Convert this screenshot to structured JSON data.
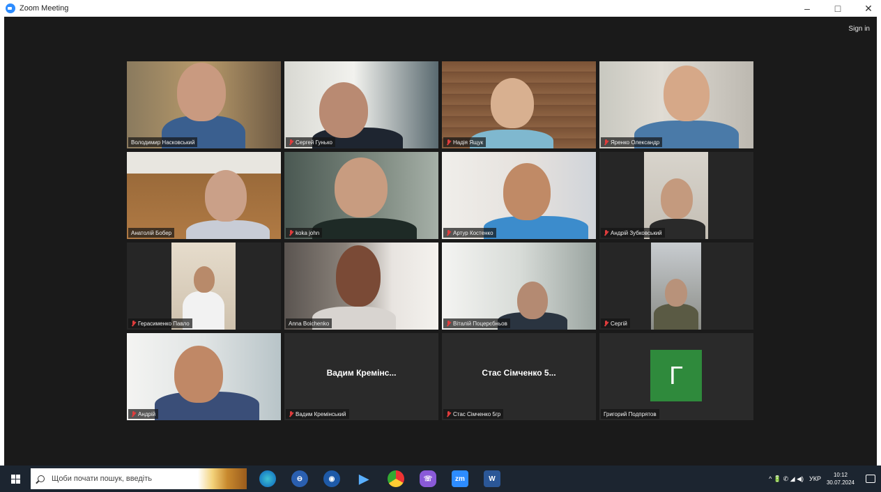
{
  "window": {
    "title": "Zoom Meeting",
    "controls": [
      "–",
      "□",
      "✕"
    ]
  },
  "meeting": {
    "sign_in": "Sign in",
    "participants": [
      {
        "name": "Володимир Насковський",
        "muted": false,
        "active": true
      },
      {
        "name": "Сергей Гунько",
        "muted": true
      },
      {
        "name": "Надія Ящук",
        "muted": true
      },
      {
        "name": "Яренко Олександр",
        "muted": true
      },
      {
        "name": "Анатолій Бобер",
        "muted": false
      },
      {
        "name": "koka john",
        "muted": true
      },
      {
        "name": "Артур Костенко",
        "muted": true
      },
      {
        "name": "Андрій Зубковський",
        "muted": true
      },
      {
        "name": "Герасименко Павло",
        "muted": true
      },
      {
        "name": "Anna Boichenko",
        "muted": false
      },
      {
        "name": "Віталій Поцерєбньов",
        "muted": true
      },
      {
        "name": "Сергій",
        "muted": true
      },
      {
        "name": "Андрій",
        "muted": true
      },
      {
        "name": "Вадим Кремінський",
        "muted": true,
        "video_off_label": "Вадим Кремінс..."
      },
      {
        "name": "Стас Сімченко 5гр",
        "muted": true,
        "video_off_label": "Стас Сімченко 5..."
      },
      {
        "name": "Григорий Подпрятов",
        "muted": false,
        "avatar_letter": "Г"
      }
    ]
  },
  "taskbar": {
    "search_placeholder": "Щоби почати пошук, введіть",
    "tray_lang": "УКР",
    "tray_symbols": "^ 🔋 ✆ ◢ ◀)",
    "time": "10:12",
    "date": "30.07.2024",
    "apps": [
      "edge-icon",
      "teams-icon",
      "zoom-chat-icon",
      "media-player-icon",
      "chrome-icon",
      "viber-icon",
      "zoom-icon",
      "word-icon"
    ]
  },
  "colors": {
    "active_speaker": "#c7e34a",
    "muted": "#e03c3c",
    "avatar_bg": "#2f8a3c"
  }
}
